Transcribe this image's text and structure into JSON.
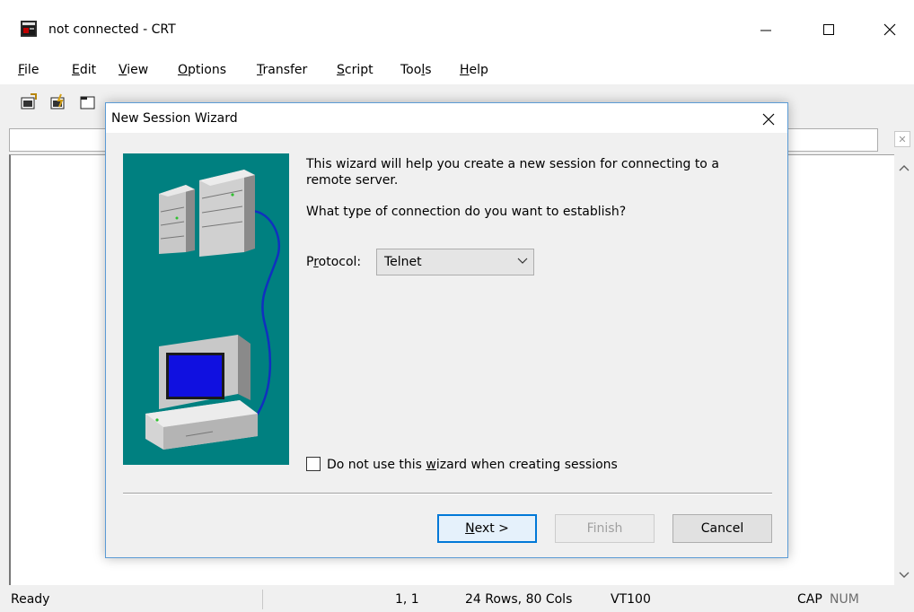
{
  "window": {
    "title": "not connected - CRT",
    "controls": {
      "minimize": "—",
      "maximize": "☐",
      "close": "✕"
    }
  },
  "menu": [
    {
      "label": "File",
      "mnemonic": "F",
      "rest": "ile"
    },
    {
      "label": "Edit",
      "mnemonic": "E",
      "rest": "dit"
    },
    {
      "label": "View",
      "mnemonic": "V",
      "rest": "iew"
    },
    {
      "label": "Options",
      "mnemonic": "O",
      "rest": "ptions"
    },
    {
      "label": "Transfer",
      "mnemonic": "T",
      "rest": "ransfer"
    },
    {
      "label": "Script",
      "mnemonic": "S",
      "rest": "cript"
    },
    {
      "label": "Tools",
      "pre": "Too",
      "mnemonic": "l",
      "rest": "s"
    },
    {
      "label": "Help",
      "mnemonic": "H",
      "rest": "elp"
    }
  ],
  "toolbar": {
    "icons": [
      "connect-icon",
      "quick-connect-icon",
      "connect-in-tab-icon"
    ]
  },
  "address_bar": {
    "value": "",
    "close_glyph": "✕"
  },
  "status_bar": {
    "state": "Ready",
    "position": "1,  1",
    "dimensions": "24 Rows,  80 Cols",
    "emulation": "VT100",
    "caps": "CAP",
    "num": "NUM"
  },
  "dialog": {
    "title": "New Session Wizard",
    "intro": "This wizard will help you create a new session for connecting to a remote server.",
    "question": "What type of connection do you want to establish?",
    "protocol_label_pre": "P",
    "protocol_label_mnemonic": "r",
    "protocol_label_rest": "otocol:",
    "protocol_value": "Telnet",
    "checkbox_pre": "Do not use this ",
    "checkbox_mnemonic": "w",
    "checkbox_rest": "izard when creating sessions",
    "checkbox_checked": false,
    "buttons": {
      "next_mnemonic": "N",
      "next_rest": "ext >",
      "finish": "Finish",
      "cancel": "Cancel"
    }
  },
  "colors": {
    "wizard_background": "#008080",
    "dialog_border": "#5b9bd5",
    "default_button_border": "#0078d7"
  }
}
